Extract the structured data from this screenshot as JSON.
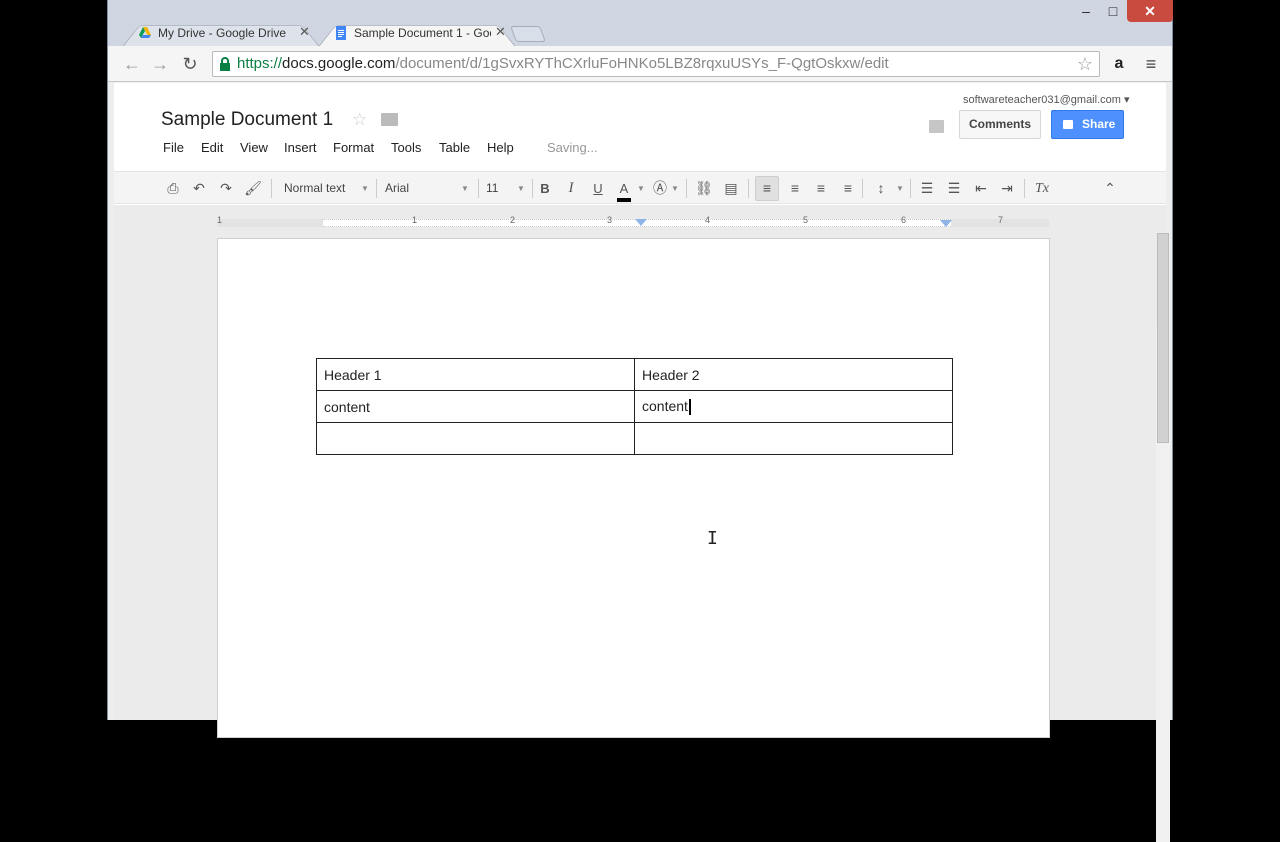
{
  "browser": {
    "tabs": [
      {
        "title": "My Drive - Google Drive",
        "icon": "google-drive-icon",
        "active": false
      },
      {
        "title": "Sample Document 1 - Goo",
        "icon": "google-docs-icon",
        "active": true
      }
    ],
    "window_controls": {
      "minimize": "–",
      "maximize": "□",
      "close": "✕"
    },
    "url": {
      "scheme": "https://",
      "host": "docs.google.com",
      "path": "/document/d/1gSvxRYThCXrluFoHNKo5LBZ8rqxuUSYs_F-QgtOskxw/edit"
    }
  },
  "docs": {
    "title": "Sample Document 1",
    "account": "softwareteacher031@gmail.com ▾",
    "comments_label": "Comments",
    "share_label": "Share",
    "saving_status": "Saving...",
    "menu": [
      "File",
      "Edit",
      "View",
      "Insert",
      "Format",
      "Tools",
      "Table",
      "Help"
    ],
    "toolbar": {
      "style": "Normal text",
      "font": "Arial",
      "size": "11",
      "bold": "B",
      "italic": "I",
      "underline": "U",
      "text_color": "A",
      "clear_formatting": "Tx",
      "text_color_value": "#000000"
    },
    "ruler_numbers": [
      "1",
      "1",
      "2",
      "3",
      "4",
      "5",
      "6",
      "7"
    ],
    "table": {
      "rows": [
        [
          "Header 1",
          "Header 2"
        ],
        [
          "content",
          "content"
        ],
        [
          "",
          ""
        ]
      ]
    }
  },
  "colors": {
    "share_blue": "#4d90fe",
    "close_red": "#c94a3f",
    "url_green": "#0b8043"
  }
}
